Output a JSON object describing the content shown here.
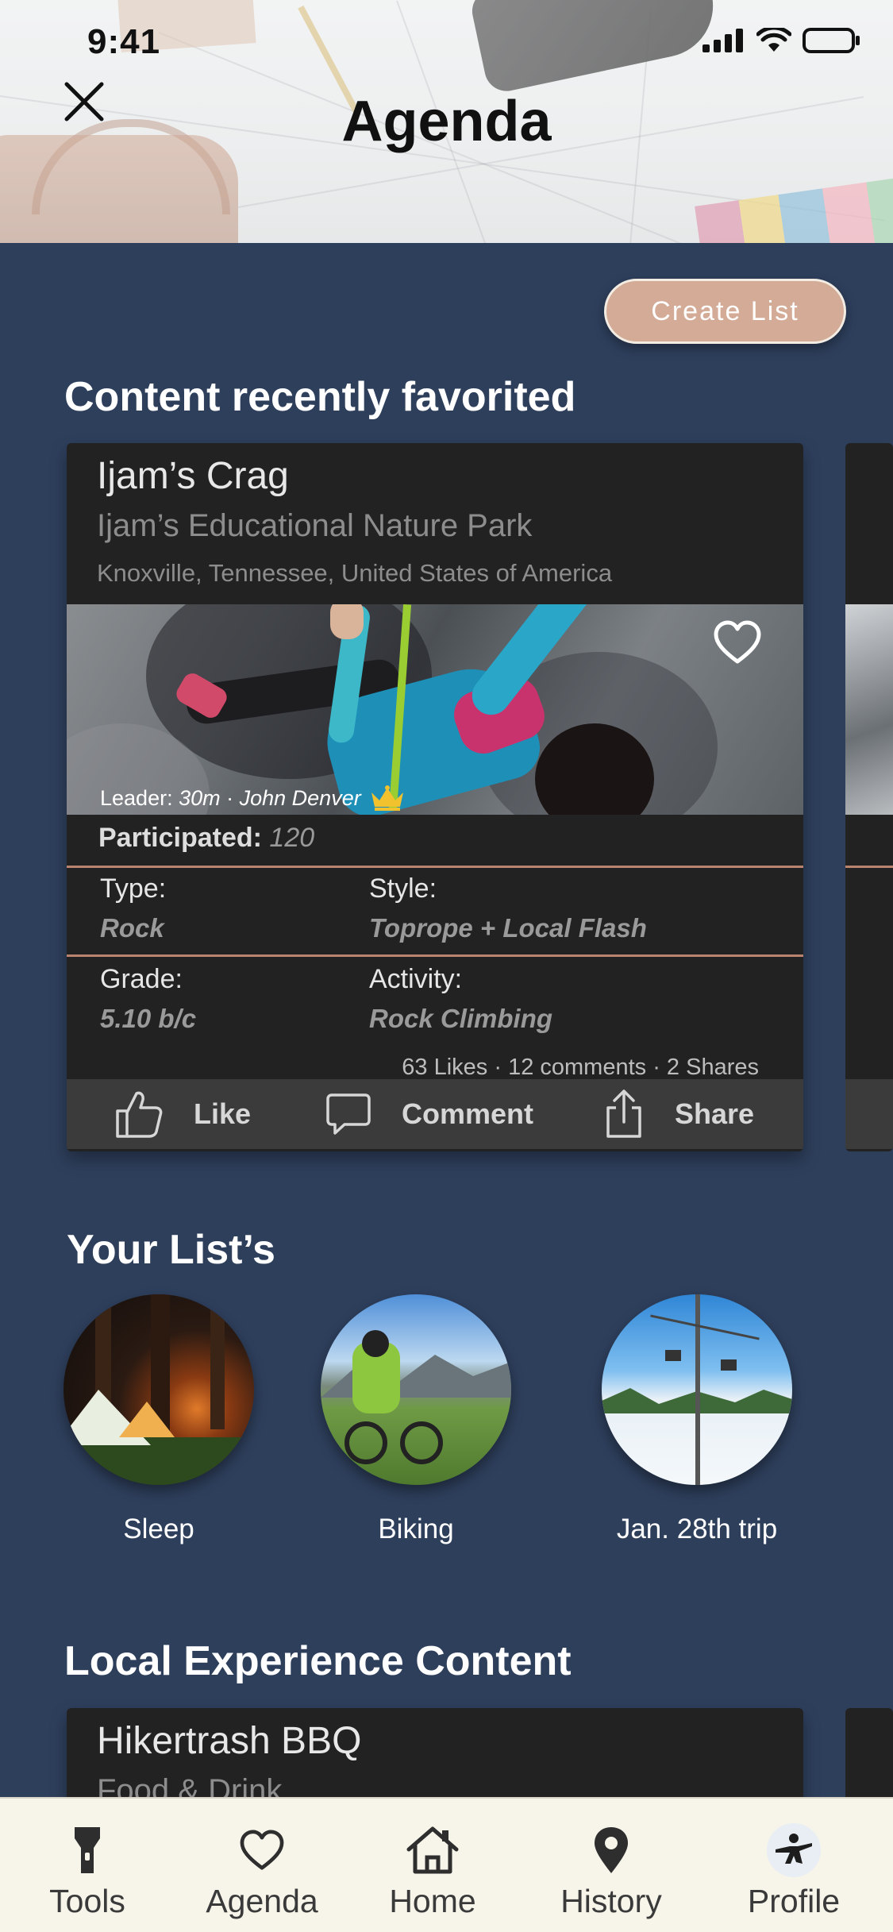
{
  "status_bar": {
    "time": "9:41"
  },
  "header": {
    "title": "Agenda"
  },
  "create_list_label": "Create List",
  "favorites": {
    "section_title": "Content recently favorited",
    "card": {
      "title": "Ijam’s Crag",
      "subtitle": "Ijam’s Educational Nature Park",
      "location": "Knoxville, Tennessee, United States of America",
      "leader_prefix": "Leader: ",
      "leader_distance": "30m",
      "leader_separator": " · ",
      "leader_name": "John Denver",
      "participated_label": "Participated:",
      "participated_value": "120",
      "type_label": "Type:",
      "type_value": "Rock",
      "style_label": "Style:",
      "style_value": "Toprope + Local Flash",
      "grade_label": "Grade:",
      "grade_value": "5.10 b/c",
      "activity_label": "Activity:",
      "activity_value": "Rock Climbing",
      "stats": "63 Likes · 12 comments · 2 Shares",
      "actions": {
        "like": "Like",
        "comment": "Comment",
        "share": "Share"
      }
    }
  },
  "lists": {
    "section_title": "Your List’s",
    "items": [
      {
        "label": "Sleep"
      },
      {
        "label": "Biking"
      },
      {
        "label": "Jan. 28th trip"
      }
    ]
  },
  "local": {
    "section_title": "Local Experience Content",
    "card": {
      "title": "Hikertrash BBQ",
      "subtitle": "Food & Drink"
    }
  },
  "tabbar": {
    "items": [
      {
        "label": "Tools",
        "icon": "flashlight-icon"
      },
      {
        "label": "Agenda",
        "icon": "heart-icon"
      },
      {
        "label": "Home",
        "icon": "home-icon"
      },
      {
        "label": "History",
        "icon": "map-pin-icon"
      },
      {
        "label": "Profile",
        "icon": "avatar-icon"
      }
    ]
  },
  "colors": {
    "background": "#2e3f5c",
    "card": "#222222",
    "accent": "#d3ab96",
    "divider": "#b88470",
    "tabbar": "#f7f4ea"
  }
}
